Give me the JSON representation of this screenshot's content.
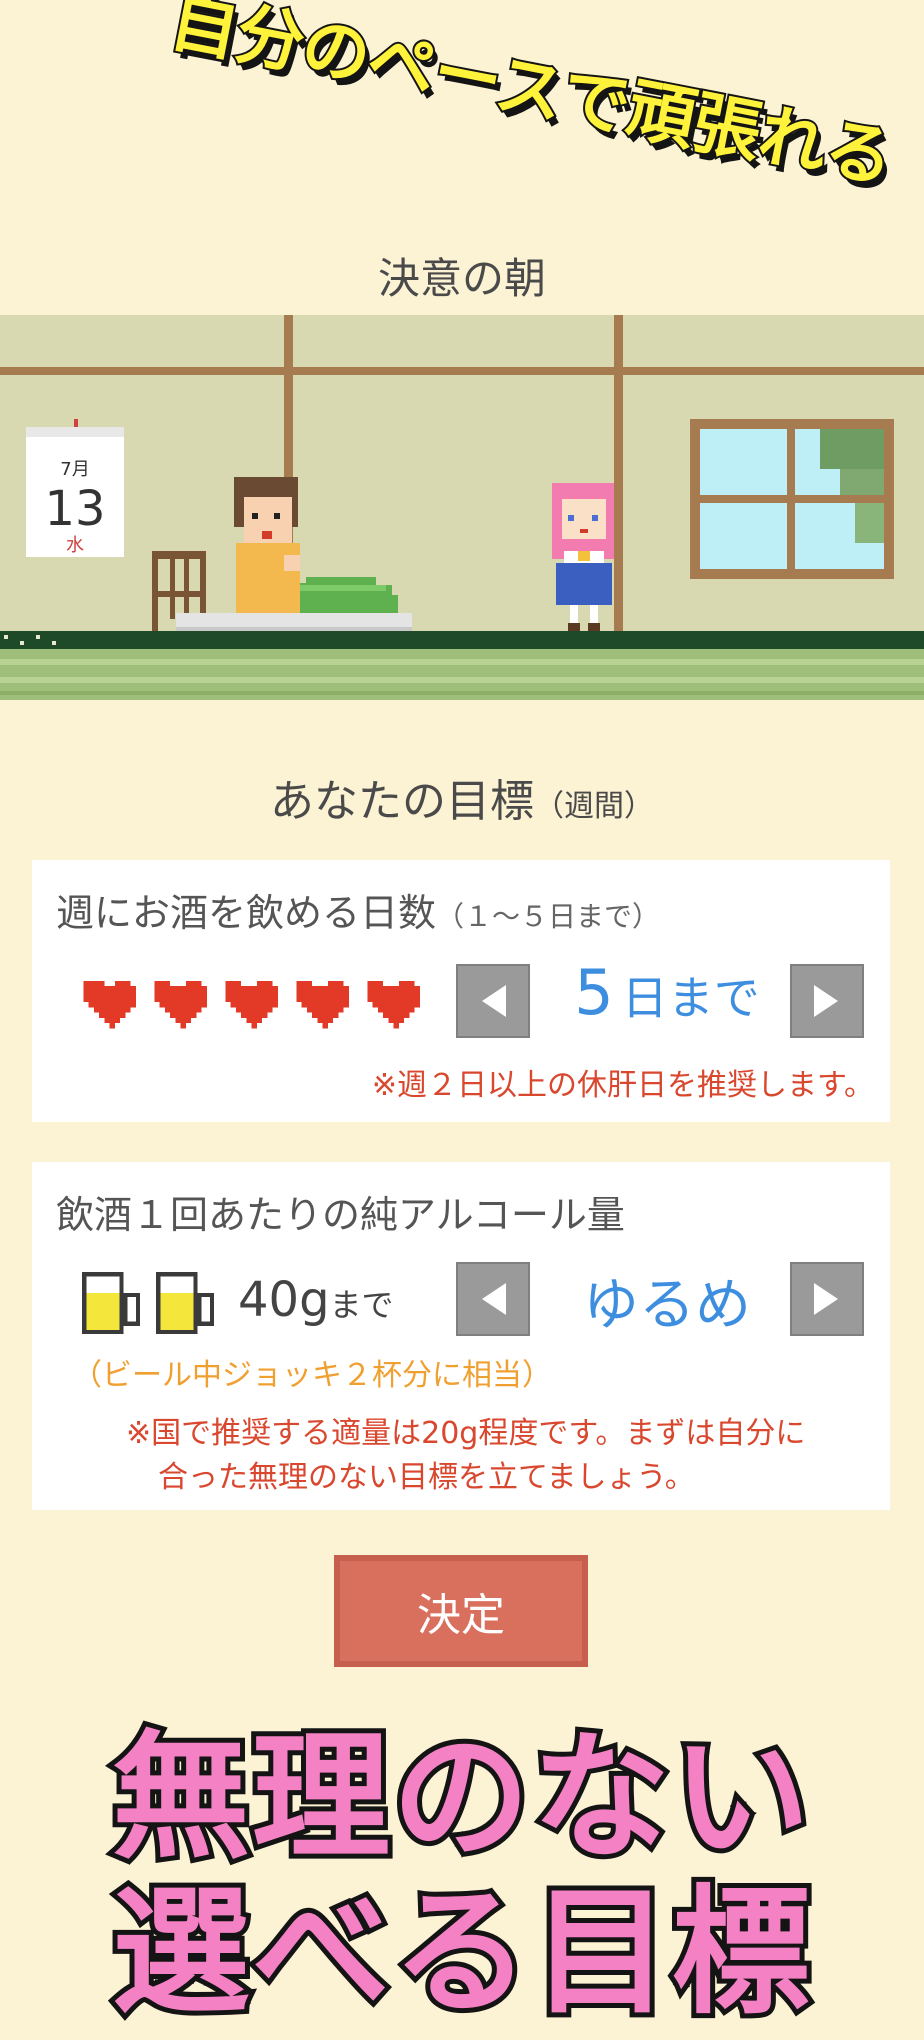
{
  "promo_top": "自分のペースで頑張れる",
  "scene": {
    "title": "決意の朝",
    "calendar": {
      "month": "7月",
      "day": "13",
      "weekday": "水"
    }
  },
  "goal": {
    "heading": "あなたの目標",
    "period": "（週間）"
  },
  "days_card": {
    "title": "週にお酒を飲める日数",
    "range": "（１～５日まで）",
    "hearts_count": 5,
    "value_number": "5",
    "value_unit": "日まで",
    "note": "※週２日以上の休肝日を推奨します。",
    "prev_icon": "triangle-left-icon",
    "next_icon": "triangle-right-icon"
  },
  "alcohol_card": {
    "title": "飲酒１回あたりの純アルコール量",
    "mugs_count": 2,
    "amount_value": "40g",
    "amount_suffix": "まで",
    "level_label": "ゆるめ",
    "equivalent": "（ビール中ジョッキ２杯分に相当）",
    "note_line1": "※国で推奨する適量は20g程度です。まずは自分に",
    "note_line2": "合った無理のない目標を立てましょう。"
  },
  "decide_label": "決定",
  "promo_bottom": {
    "line1": "無理のない",
    "line2": "選べる目標"
  },
  "colors": {
    "accent_blue": "#3E8EE0",
    "note_red": "#D9472E",
    "orange": "#F0A030",
    "promo_pink": "#F481C4",
    "button_red": "#D9705D"
  }
}
